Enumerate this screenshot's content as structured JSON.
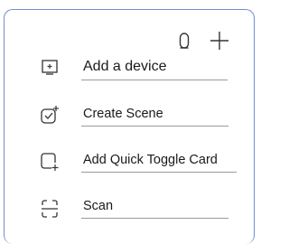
{
  "menu": {
    "items": [
      {
        "label": "Add a device",
        "icon": "add-device-icon"
      },
      {
        "label": "Create Scene",
        "icon": "create-scene-icon"
      },
      {
        "label": "Add Quick Toggle Card",
        "icon": "quick-toggle-card-icon"
      },
      {
        "label": "Scan",
        "icon": "scan-icon"
      }
    ]
  },
  "toolbar": {
    "icons": [
      "microphone-icon",
      "plus-icon"
    ]
  },
  "colors": {
    "panel_border": "#6f8fcf",
    "text": "#1a1a1a",
    "underline": "#9a9a9a",
    "icon": "#333333"
  }
}
